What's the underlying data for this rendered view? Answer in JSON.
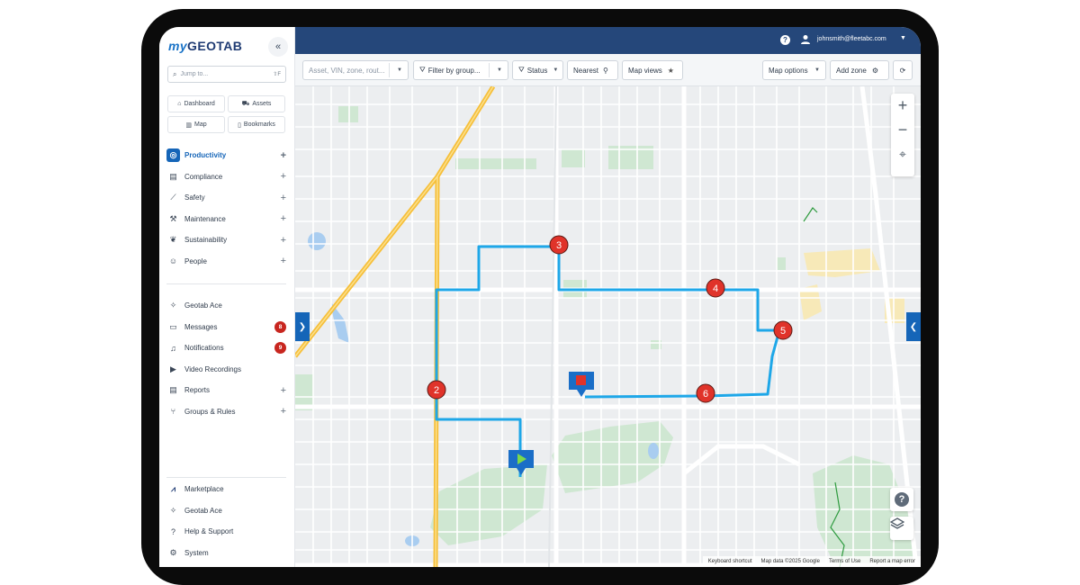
{
  "sidebar": {
    "logo_my": "my",
    "logo_geotab": "GEOTAB",
    "collapse": "«",
    "jump_placeholder": "Jump to...",
    "jump_shortcut": "⇧F",
    "quick_links": [
      {
        "label": "Dashboard",
        "icon": "home-icon"
      },
      {
        "label": "Assets",
        "icon": "truck-icon"
      },
      {
        "label": "Map",
        "icon": "map-icon"
      },
      {
        "label": "Bookmarks",
        "icon": "bookmark-icon"
      }
    ],
    "nav": [
      {
        "label": "Productivity",
        "icon": "globe-icon",
        "expandable": true,
        "active": true
      },
      {
        "label": "Compliance",
        "icon": "clipboard-icon",
        "expandable": true
      },
      {
        "label": "Safety",
        "icon": "seatbelt-icon",
        "expandable": true
      },
      {
        "label": "Maintenance",
        "icon": "wrench-icon",
        "expandable": true
      },
      {
        "label": "Sustainability",
        "icon": "leaf-icon",
        "expandable": true
      },
      {
        "label": "People",
        "icon": "people-icon",
        "expandable": true
      }
    ],
    "nav2": [
      {
        "label": "Geotab Ace",
        "icon": "sparkle-icon"
      },
      {
        "label": "Messages",
        "icon": "messages-icon",
        "badge": "8"
      },
      {
        "label": "Notifications",
        "icon": "bell-icon",
        "badge": "9"
      },
      {
        "label": "Video Recordings",
        "icon": "video-icon"
      },
      {
        "label": "Reports",
        "icon": "report-icon",
        "expandable": true
      },
      {
        "label": "Groups & Rules",
        "icon": "groups-icon",
        "expandable": true
      }
    ],
    "footer": [
      {
        "label": "Marketplace",
        "icon": "marketplace-icon"
      },
      {
        "label": "Geotab Ace",
        "icon": "sparkle-icon"
      },
      {
        "label": "Help & Support",
        "icon": "help-icon"
      },
      {
        "label": "System",
        "icon": "gear-icon"
      }
    ]
  },
  "topbar": {
    "help": "?",
    "user_email": "johnsmith@fleetabc.com"
  },
  "toolbar": {
    "search_placeholder": "Asset, VIN, zone, rout...",
    "filter_label": "Filter by group...",
    "status_label": "Status",
    "nearest_label": "Nearest",
    "map_views_label": "Map views",
    "map_options_label": "Map options",
    "add_zone_label": "Add zone"
  },
  "map": {
    "stops": [
      "2",
      "3",
      "4",
      "5",
      "6"
    ],
    "route_color": "#1ea7e8",
    "marker_color": "#d93025",
    "attribution": [
      "Keyboard shortcut",
      "Map data ©2025 Google",
      "Terms of Use",
      "Report a map error"
    ]
  },
  "colors": {
    "primary": "#1565b8",
    "topbar": "#25477a",
    "badge": "#c8261f"
  }
}
